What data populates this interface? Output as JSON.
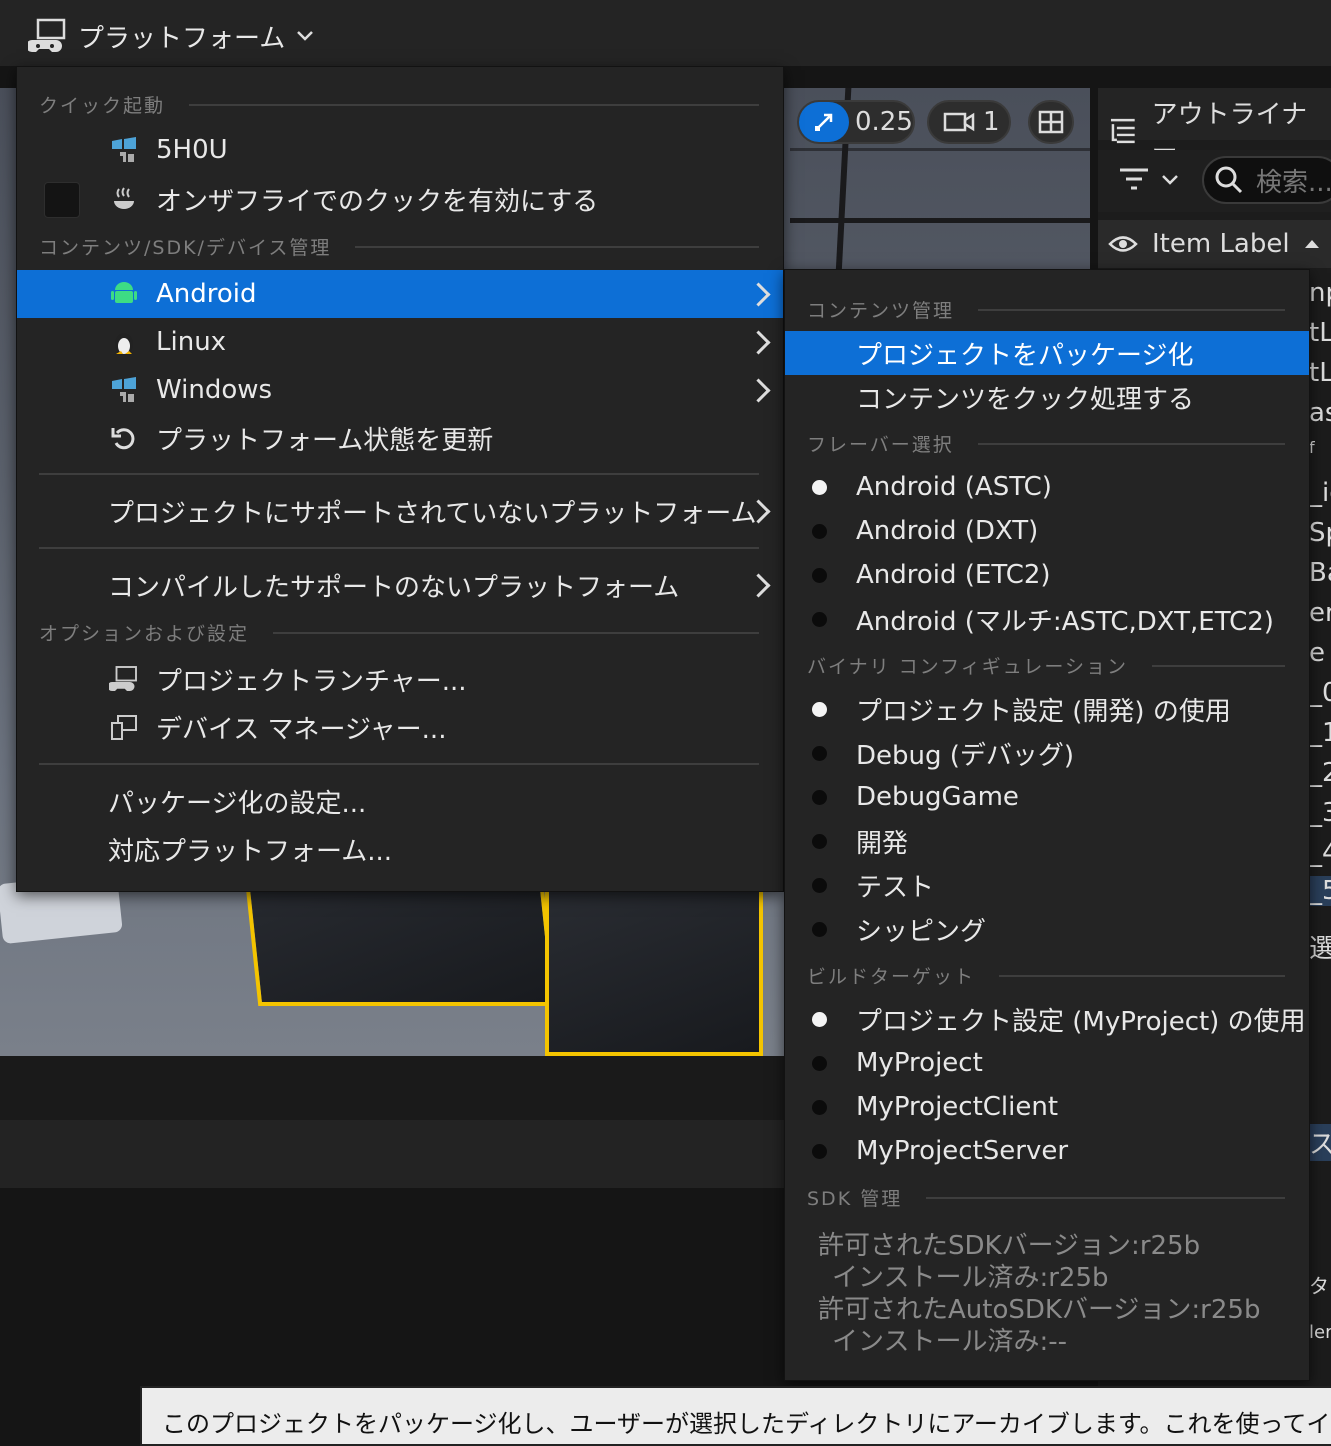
{
  "toolbar": {
    "platforms_label": "プラットフォーム"
  },
  "viewport": {
    "snap_value": "0.25",
    "camera_speed": "1"
  },
  "outliner": {
    "title": "アウトライナー",
    "search_placeholder": "検索...",
    "column_label": "Item Label",
    "row_fragments": [
      "np",
      "tL",
      "tL",
      "as",
      "f",
      "_ig",
      "Sp",
      "Ba",
      "er",
      "e",
      "_0",
      "_1",
      "_2",
      "_3",
      "_4",
      "_5",
      "選折",
      "ス",
      "タ",
      "ler"
    ]
  },
  "main_menu": {
    "sections": {
      "quick_launch": "クイック起動",
      "content_sdk": "コンテンツ/SDK/デバイス管理",
      "options": "オプションおよび設定"
    },
    "items": {
      "device": "5H0U",
      "cook_on_fly": "オンザフライでのクックを有効にする",
      "android": "Android",
      "linux": "Linux",
      "windows": "Windows",
      "refresh": "プラットフォーム状態を更新",
      "unsupported_project": "プロジェクトにサポートされていないプラットフォーム",
      "unsupported_compiled": "コンパイルしたサポートのないプラットフォーム",
      "project_launcher": "プロジェクトランチャー...",
      "device_manager": "デバイス マネージャー...",
      "packaging_settings": "パッケージ化の設定...",
      "supported_platforms": "対応プラットフォーム..."
    }
  },
  "sub_menu": {
    "sections": {
      "content": "コンテンツ管理",
      "flavor": "フレーバー選択",
      "binary": "バイナリ コンフィギュレーション",
      "build_target": "ビルドターゲット",
      "sdk": "SDK 管理"
    },
    "content_items": [
      "プロジェクトをパッケージ化",
      "コンテンツをクック処理する"
    ],
    "flavors": [
      {
        "label": "Android (ASTC)",
        "selected": true
      },
      {
        "label": "Android (DXT)",
        "selected": false
      },
      {
        "label": "Android (ETC2)",
        "selected": false
      },
      {
        "label": "Android (マルチ:ASTC,DXT,ETC2)",
        "selected": false
      }
    ],
    "binaries": [
      {
        "label": "プロジェクト設定 (開発) の使用",
        "selected": true
      },
      {
        "label": "Debug (デバッグ)",
        "selected": false
      },
      {
        "label": "DebugGame",
        "selected": false
      },
      {
        "label": "開発",
        "selected": false
      },
      {
        "label": "テスト",
        "selected": false
      },
      {
        "label": "シッピング",
        "selected": false
      }
    ],
    "targets": [
      {
        "label": "プロジェクト設定 (MyProject) の使用",
        "selected": true
      },
      {
        "label": "MyProject",
        "selected": false
      },
      {
        "label": "MyProjectClient",
        "selected": false
      },
      {
        "label": "MyProjectServer",
        "selected": false
      }
    ],
    "sdk_lines": [
      "許可されたSDKバージョン:r25b",
      "インストール済み:r25b",
      "許可されたAutoSDKバージョン:r25b",
      "インストール済み:--"
    ]
  },
  "tooltip": {
    "text": "このプロジェクトをパッケージ化し、ユーザーが選択したディレクトリにアーカイブします。これを使ってインストールおよび"
  },
  "colors": {
    "accent": "#0d6fd6",
    "menu_bg": "#242424",
    "highlight_yellow": "#f4c400"
  }
}
